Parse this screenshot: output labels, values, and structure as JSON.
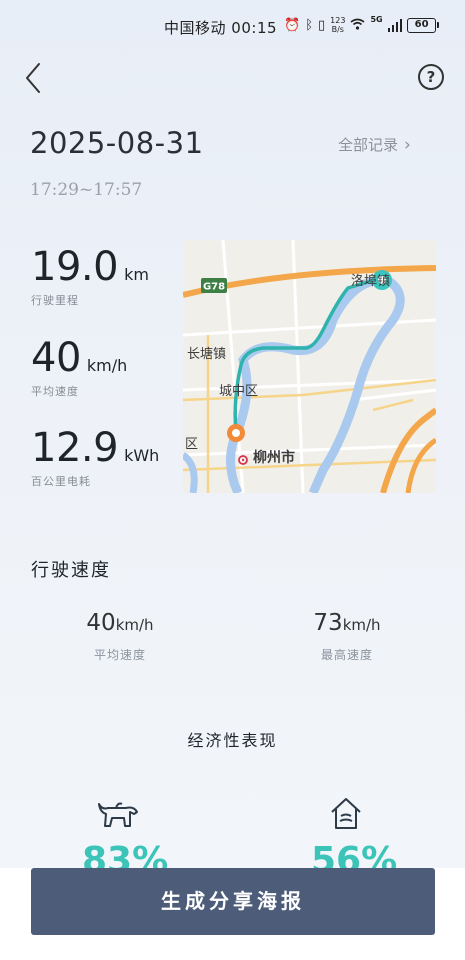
{
  "status_bar": {
    "carrier": "中国移动",
    "time": "00:15",
    "net_speed_value": "123",
    "net_speed_unit": "B/s",
    "network_type": "5G",
    "battery": "60"
  },
  "header": {
    "date": "2025-08-31",
    "all_records": "全部记录",
    "time_range": "17:29~17:57"
  },
  "stats": {
    "distance": {
      "value": "19.0",
      "unit": "km",
      "label": "行驶里程"
    },
    "avg_speed": {
      "value": "40",
      "unit": "km/h",
      "label": "平均速度"
    },
    "energy": {
      "value": "12.9",
      "unit": "kWh",
      "label": "百公里电耗"
    }
  },
  "map": {
    "labels": {
      "highway": "G78",
      "town_top": "洛埠镇",
      "town_left": "长塘镇",
      "district": "城中区",
      "district_edge": "区",
      "city": "柳州市"
    },
    "colors": {
      "route": "#2fb3ad",
      "start": "#f28a3a",
      "end": "#3cc4c0",
      "river": "#a9c9ee",
      "road": "#f3a64a"
    }
  },
  "driving_speed": {
    "title": "行驶速度",
    "avg": {
      "value": "40",
      "unit": "km/h",
      "label": "平均速度"
    },
    "max": {
      "value": "73",
      "unit": "km/h",
      "label": "最高速度"
    }
  },
  "economy": {
    "title": "经济性表现",
    "left_percent": "83%",
    "right_percent": "56%",
    "left_icon": "bull-icon",
    "right_icon": "house-wind-icon",
    "accent": "#3cc4b8"
  },
  "share_button": "生成分享海报"
}
